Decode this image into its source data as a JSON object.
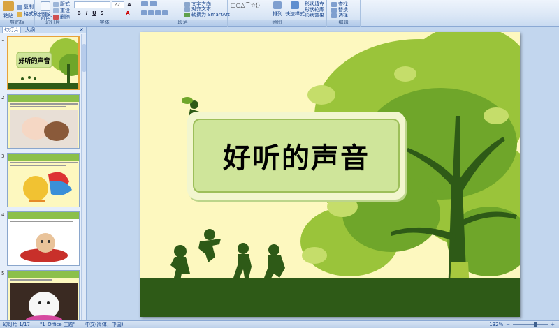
{
  "ribbon": {
    "clipboard": {
      "group_label": "剪贴板",
      "paste_label": "粘贴",
      "copy_label": "复制",
      "format_painter_label": "格式刷"
    },
    "slides": {
      "group_label": "幻灯片",
      "new_slide_label": "新建幻灯片",
      "layout_label": "版式",
      "reset_label": "重设",
      "delete_label": "删除"
    },
    "font": {
      "group_label": "字体",
      "font_size": "22",
      "bold": "B",
      "italic": "I",
      "underline": "U",
      "strike": "S"
    },
    "paragraph": {
      "group_label": "段落",
      "text_direction_label": "文字方向",
      "align_text_label": "对齐文本",
      "smartart_label": "转换为 SmartArt"
    },
    "drawing": {
      "group_label": "绘图",
      "arrange_label": "排列",
      "quick_styles_label": "快速样式",
      "shape_fill_label": "形状填充",
      "shape_outline_label": "形状轮廓",
      "shape_effects_label": "形状效果"
    },
    "editing": {
      "group_label": "编辑",
      "find_label": "查找",
      "replace_label": "替换",
      "select_label": "选择"
    }
  },
  "left_pane": {
    "tabs": [
      "幻灯片",
      "大纲"
    ],
    "close_symbol": "×",
    "slide_numbers": [
      "1",
      "2",
      "3",
      "4",
      "5"
    ],
    "thumb1_title": "好听的声音"
  },
  "slide": {
    "title": "好听的声音"
  },
  "statusbar": {
    "slide_info": "幻灯片 1/17",
    "theme": "\"1_Office 主题\"",
    "language": "中文(简体，中国)",
    "zoom": "132%"
  },
  "colors": {
    "tree_light": "#9ac43a",
    "tree_dark": "#2e5a17",
    "slide_bg": "#fdf8bf"
  }
}
